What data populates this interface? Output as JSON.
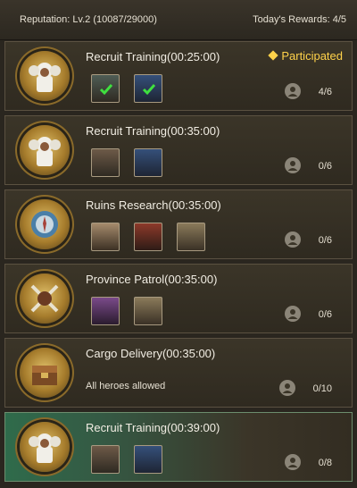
{
  "header": {
    "reputation": "Reputation: Lv.2 (10087/29000)",
    "rewards": "Today's Rewards: 4/5"
  },
  "tasks": [
    {
      "title": "Recruit Training(00:25:00)",
      "status": "Participated",
      "emblem": "recruit-emblem",
      "heroes": [
        "hero-bearded-warrior-checked",
        "hero-masked-blue-checked"
      ],
      "slots": "4/6"
    },
    {
      "title": "Recruit Training(00:35:00)",
      "emblem": "recruit-emblem",
      "heroes": [
        "hero-bearded-warrior",
        "hero-masked-blue"
      ],
      "slots": "0/6"
    },
    {
      "title": "Ruins Research(00:35:00)",
      "emblem": "ruins-emblem",
      "heroes": [
        "hero-old-scholar",
        "hero-red-hair-woman",
        "hero-helmet-warrior"
      ],
      "slots": "0/6"
    },
    {
      "title": "Province Patrol(00:35:00)",
      "emblem": "patrol-emblem",
      "heroes": [
        "hero-purple-woman",
        "hero-helmet-warrior"
      ],
      "slots": "0/6"
    },
    {
      "title": "Cargo Delivery(00:35:00)",
      "emblem": "cargo-emblem",
      "note": "All heroes allowed",
      "slots": "0/10"
    },
    {
      "title": "Recruit Training(00:39:00)",
      "emblem": "recruit-emblem",
      "heroes": [
        "hero-bearded-warrior",
        "hero-masked-blue"
      ],
      "slots": "0/8"
    }
  ],
  "colors": {
    "accent": "#ffd24a",
    "active_bg": "#2f6b4b"
  }
}
